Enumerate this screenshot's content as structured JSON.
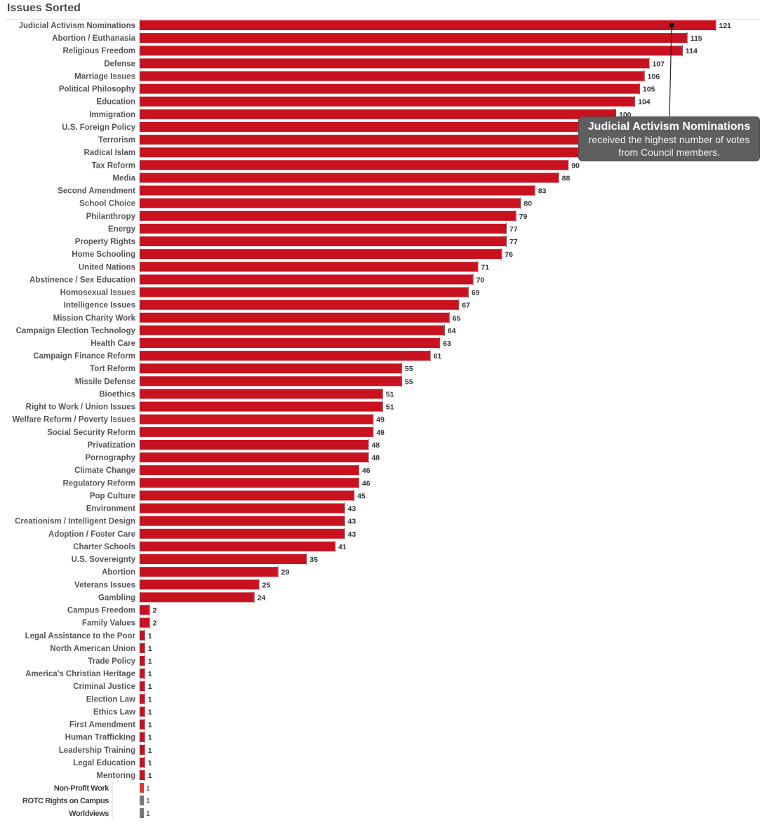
{
  "chart_data": {
    "type": "bar",
    "orientation": "horizontal",
    "title": "Issues Sorted",
    "xlabel": "",
    "ylabel": "",
    "xlim": [
      0,
      125
    ],
    "grid": false,
    "legend": "none",
    "bar_color": "#c8121f",
    "alt_colors": {
      "Non-Profit Work": "#d9392f",
      "ROTC Rights on Campus": "#777777",
      "Worldviews": "#777777"
    },
    "categories": [
      "Judicial Activism Nominations",
      "Abortion / Euthanasia",
      "Religious Freedom",
      "Defense",
      "Marriage Issues",
      "Political Philosophy",
      "Education",
      "Immigration",
      "U.S. Foreign Policy",
      "Terrorism",
      "Radical Islam",
      "Tax Reform",
      "Media",
      "Second Amendment",
      "School Choice",
      "Philanthropy",
      "Energy",
      "Property Rights",
      "Home Schooling",
      "United Nations",
      "Abstinence / Sex Education",
      "Homosexual Issues",
      "Intelligence Issues",
      "Mission Charity Work",
      "Campaign Election Technology",
      "Health Care",
      "Campaign Finance Reform",
      "Tort Reform",
      "Missile Defense",
      "Bioethics",
      "Right to Work / Union Issues",
      "Welfare Reform / Poverty Issues",
      "Social Security Reform",
      "Privatization",
      "Pornography",
      "Climate Change",
      "Regulatory Reform",
      "Pop Culture",
      "Environment",
      "Creationism / Intelligent Design",
      "Adoption / Foster Care",
      "Charter Schools",
      "U.S. Sovereignty",
      "Abortion",
      "Veterans Issues",
      "Gambling",
      "Campus Freedom",
      "Family Values",
      "Legal Assistance to the Poor",
      "North American Union",
      "Trade Policy",
      "America's Christian Heritage",
      "Criminal Justice",
      "Election Law",
      "Ethics Law",
      "First Amendment",
      "Human Trafficking",
      "Leadership Training",
      "Legal Education",
      "Mentoring",
      "Non-Profit Work",
      "ROTC Rights on Campus",
      "Worldviews"
    ],
    "values": [
      121,
      115,
      114,
      107,
      106,
      105,
      104,
      100,
      97,
      96,
      95,
      90,
      88,
      83,
      80,
      79,
      77,
      77,
      76,
      71,
      70,
      69,
      67,
      65,
      64,
      63,
      61,
      55,
      55,
      51,
      51,
      49,
      49,
      48,
      48,
      46,
      46,
      45,
      43,
      43,
      43,
      41,
      35,
      29,
      25,
      24,
      2,
      2,
      1,
      1,
      1,
      1,
      1,
      1,
      1,
      1,
      1,
      1,
      1,
      1,
      1,
      1,
      1
    ],
    "data_labels_hidden": [
      "U.S. Foreign Policy",
      "Terrorism",
      "Radical Islam"
    ],
    "annotation": {
      "target": "Judicial Activism Nominations",
      "heading": "Judicial Activism Nominations",
      "text": "received the highest number of votes from Council members."
    }
  },
  "tooltip": {
    "heading": "Judicial Activism Nominations",
    "line1": "received the highest number of votes",
    "line2": "from Council members."
  }
}
